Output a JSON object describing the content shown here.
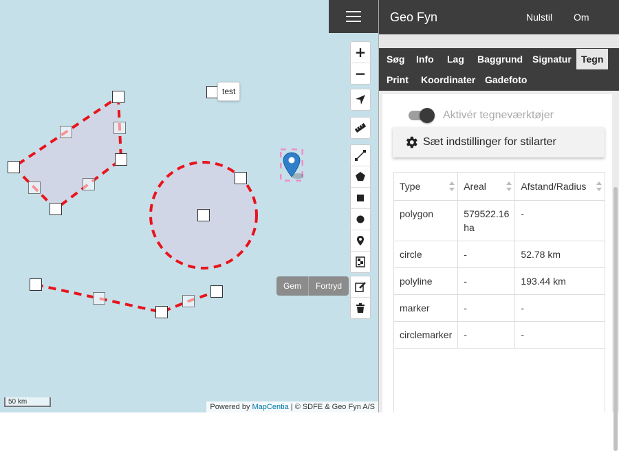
{
  "map": {
    "tooltip_text": "test",
    "edit_actions": {
      "save_label": "Gem",
      "undo_label": "Fortryd"
    },
    "scale_label": "50 km",
    "attribution": {
      "prefix": "Powered by ",
      "link": "MapCentia",
      "suffix": " | © SDFE & Geo Fyn A/S"
    },
    "zoom": {
      "in_label": "+",
      "out_label": "−"
    },
    "accent_stroke": "#e8141c",
    "shape_fill": "#d2d4e6",
    "marker_color": "#2f7fcb"
  },
  "header": {
    "title": "Geo Fyn",
    "nav": [
      "Nulstil",
      "Om"
    ]
  },
  "tabs": [
    {
      "label": "Søg",
      "active": false
    },
    {
      "label": "Info",
      "active": false
    },
    {
      "label": "Lag",
      "active": false
    },
    {
      "label": "Baggrund",
      "active": false
    },
    {
      "label": "Signatur",
      "active": false
    },
    {
      "label": "Tegn",
      "active": true
    },
    {
      "label": "Print",
      "active": false
    },
    {
      "label": "Koordinater",
      "active": false
    },
    {
      "label": "Gadefoto",
      "active": false
    }
  ],
  "draw": {
    "toggle_label": "Aktivér tegneværktøjer",
    "toggle_on": true,
    "style_button_label": "Sæt indstillinger for stilarter",
    "table": {
      "headers": [
        "Type",
        "Areal",
        "Afstand/Radius"
      ],
      "rows": [
        [
          "polygon",
          "579522.16 ha",
          "-"
        ],
        [
          "circle",
          "-",
          "52.78 km"
        ],
        [
          "polyline",
          "-",
          "193.44 km"
        ],
        [
          "marker",
          "-",
          "-"
        ],
        [
          "circlemarker",
          "-",
          "-"
        ]
      ]
    }
  }
}
